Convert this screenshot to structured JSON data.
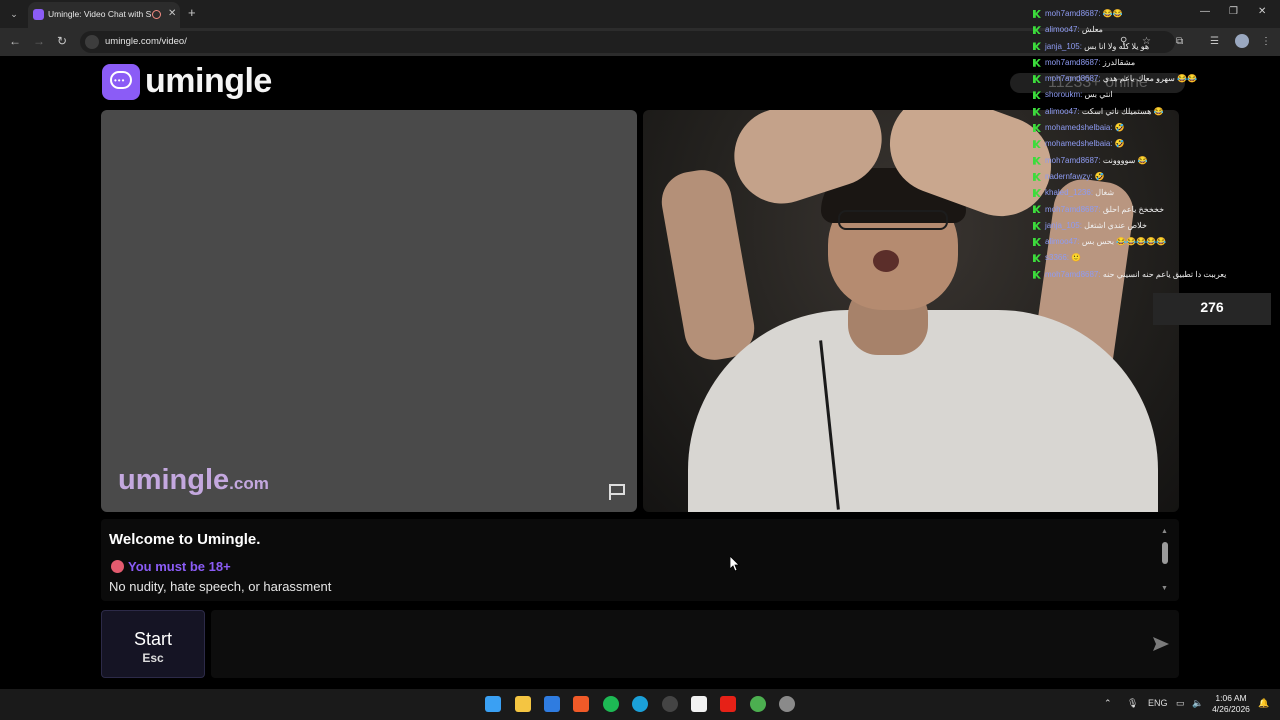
{
  "browser": {
    "tab_title": "Umingle: Video Chat with S",
    "url": "umingle.com/video/"
  },
  "site": {
    "logo_text": "umingle",
    "online_count": "11233+ online",
    "watermark": "umingle",
    "watermark_suffix": ".com",
    "accent_color": "#8b5cf6"
  },
  "chat_log": {
    "welcome": "Welcome to Umingle.",
    "age_warning": "You must be 18+",
    "rules": "No nudity, hate speech, or harassment"
  },
  "controls": {
    "start_label": "Start",
    "start_shortcut": "Esc",
    "message_placeholder": ""
  },
  "overlay": {
    "messages": [
      {
        "user": "moh7amd8687:",
        "text": "😂😂"
      },
      {
        "user": "alimoo47:",
        "text": "معلش"
      },
      {
        "user": "janja_105:",
        "text": "هو يلا كله ولا انا بس"
      },
      {
        "user": "moh7amd8687:",
        "text": "مشقالدرز"
      },
      {
        "user": "moh7amd8687:",
        "text": "سهرو معاك ياعم هدي 😂😂"
      },
      {
        "user": "shoroukm:",
        "text": "انتي بس"
      },
      {
        "user": "alimoo47:",
        "text": "هستميلك ناتي اسكت 😂"
      },
      {
        "user": "mohamedshelbaia:",
        "text": "🤣"
      },
      {
        "user": "mohamedshelbaia:",
        "text": "🤣"
      },
      {
        "user": "moh7amd8687:",
        "text": "سوووونت 😂"
      },
      {
        "user": "nadernfawzy:",
        "text": "🤣"
      },
      {
        "user": "khaled_1236:",
        "text": "شغال"
      },
      {
        "user": "moh7amd8687:",
        "text": "خخخخخ ياعم احلق"
      },
      {
        "user": "janja_105:",
        "text": "خلاص عندي اشتغل"
      },
      {
        "user": "alimoo47:",
        "text": "بحس بس 😂😂😂😂😂"
      },
      {
        "user": "s3366:",
        "text": "🙂"
      },
      {
        "user": "moh7amd8687:",
        "text": "يعرببت دا تطبيق ياعم حنه انسيني حنه"
      }
    ],
    "viewer_count": "276"
  },
  "taskbar": {
    "language": "ENG",
    "time": "1:06 AM",
    "date": "4/26/2026"
  }
}
